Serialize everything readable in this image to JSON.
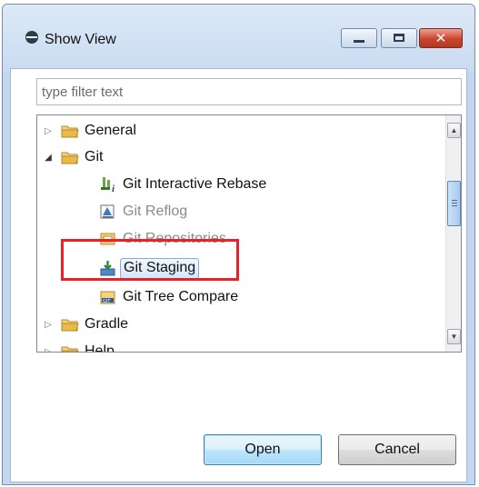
{
  "window": {
    "title": "Show View",
    "icon": "show-view-icon",
    "controls": {
      "minimize_icon": "minimize-icon",
      "maximize_icon": "maximize-icon",
      "close_glyph": "✕"
    }
  },
  "filter": {
    "placeholder": "type filter text",
    "value": ""
  },
  "tree": {
    "items": [
      {
        "label": "General",
        "type": "folder",
        "expanded": false
      },
      {
        "label": "Git",
        "type": "folder",
        "expanded": true,
        "children": [
          {
            "label": "Git Interactive Rebase",
            "icon": "interactive-rebase-icon"
          },
          {
            "label": "Git Reflog",
            "icon": "reflog-icon"
          },
          {
            "label": "Git Repositories",
            "icon": "repositories-icon"
          },
          {
            "label": "Git Staging",
            "icon": "staging-icon",
            "selected": true
          },
          {
            "label": "Git Tree Compare",
            "icon": "tree-compare-icon"
          }
        ]
      },
      {
        "label": "Gradle",
        "type": "folder",
        "expanded": false
      },
      {
        "label": "Help",
        "type": "folder",
        "expanded": false
      }
    ],
    "twisty_collapsed": "▷",
    "twisty_expanded": "◢"
  },
  "buttons": {
    "open_label": "Open",
    "cancel_label": "Cancel"
  },
  "colors": {
    "highlight_box": "#e8222a",
    "selection_border": "#84acdd",
    "folder": "#e9b949"
  }
}
